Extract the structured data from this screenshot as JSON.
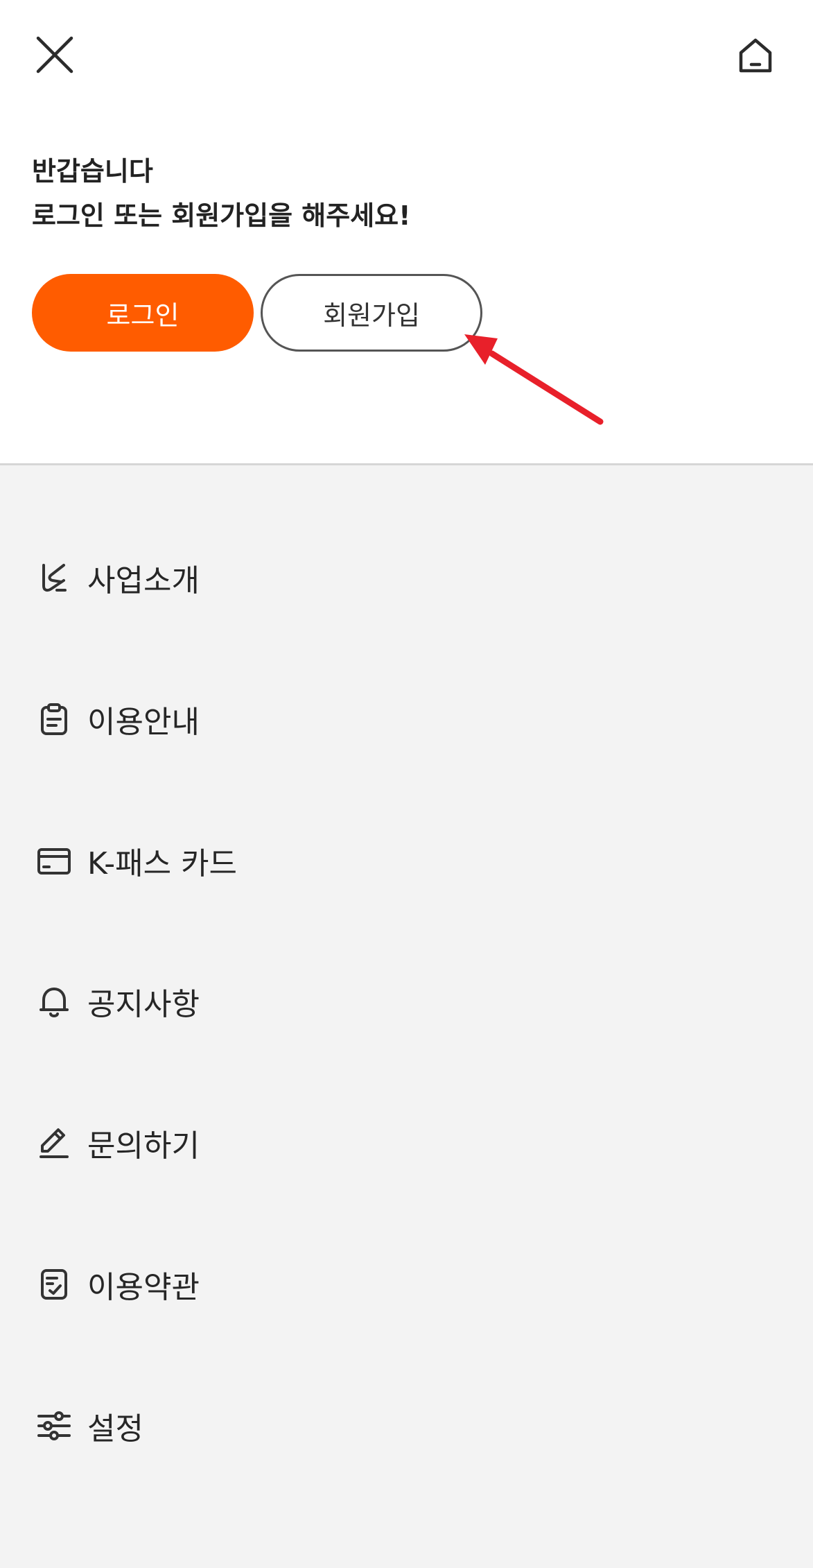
{
  "header": {
    "close_icon": "close-icon",
    "home_icon": "home-icon"
  },
  "welcome": {
    "line1": "반갑습니다",
    "line2": "로그인 또는 회원가입을 해주세요!"
  },
  "buttons": {
    "login": "로그인",
    "signup": "회원가입"
  },
  "annotation": {
    "arrow_color": "#e8202a"
  },
  "colors": {
    "accent": "#ff5c00",
    "menu_background": "#f3f3f3"
  },
  "menu": {
    "items": [
      {
        "label": "사업소개",
        "icon": "logo-k-icon"
      },
      {
        "label": "이용안내",
        "icon": "clipboard-icon"
      },
      {
        "label": "K-패스 카드",
        "icon": "card-icon"
      },
      {
        "label": "공지사항",
        "icon": "bell-icon"
      },
      {
        "label": "문의하기",
        "icon": "pencil-icon"
      },
      {
        "label": "이용약관",
        "icon": "document-check-icon"
      },
      {
        "label": "설정",
        "icon": "sliders-icon"
      }
    ]
  }
}
